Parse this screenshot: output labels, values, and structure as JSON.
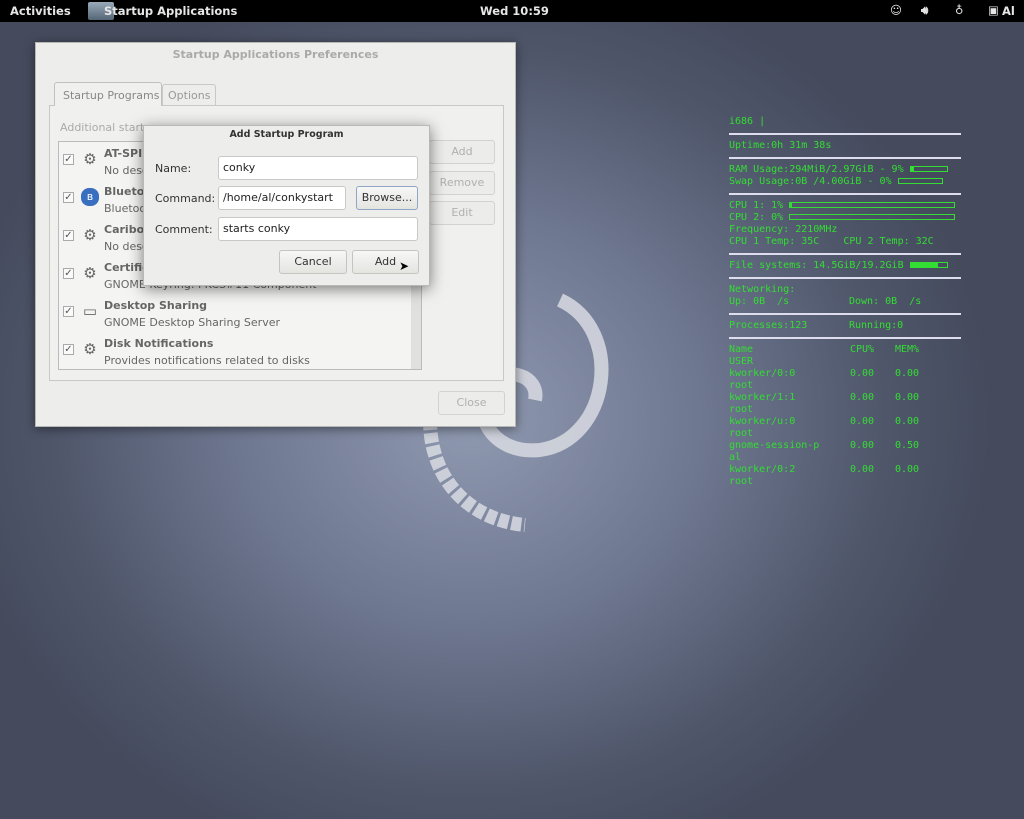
{
  "topbar": {
    "activities": "Activities",
    "app": "Startup Applications",
    "clock": "Wed 10:59",
    "user": "Al"
  },
  "main_window": {
    "title": "Startup Applications Preferences",
    "tabs": [
      "Startup Programs",
      "Options"
    ],
    "list_label": "Additional startup programs:",
    "items": [
      {
        "title": "AT-SPI",
        "subtitle": "No description",
        "icon": "gears-icon",
        "checked": true
      },
      {
        "title": "Bluetooth",
        "subtitle": "Bluetooth",
        "icon": "bluetooth-icon",
        "checked": true
      },
      {
        "title": "Caribou",
        "subtitle": "No description",
        "icon": "gears-icon",
        "checked": true
      },
      {
        "title": "Certificate",
        "subtitle": "GNOME Keyring: PKCS#11 Component",
        "icon": "gears-icon",
        "checked": true
      },
      {
        "title": "Desktop Sharing",
        "subtitle": "GNOME Desktop Sharing Server",
        "icon": "monitor-icon",
        "checked": true
      },
      {
        "title": "Disk Notifications",
        "subtitle": "Provides notifications related to disks",
        "icon": "gears-icon",
        "checked": true
      }
    ],
    "buttons": {
      "add": "Add",
      "remove": "Remove",
      "edit": "Edit",
      "close": "Close"
    }
  },
  "dialog": {
    "title": "Add Startup Program",
    "name_label": "Name:",
    "name_value": "conky",
    "command_label": "Command:",
    "command_value": "/home/al/conkystart",
    "browse": "Browse...",
    "comment_label": "Comment:",
    "comment_value": "starts conky",
    "cancel": "Cancel",
    "add": "Add"
  },
  "conky": {
    "arch": "i686 |",
    "uptime": "Uptime:0h 31m 38s",
    "ram": "RAM Usage:294MiB/2.97GiB - 9%",
    "ram_pct": 9,
    "swap": "Swap Usage:0B  /4.00GiB - 0%",
    "swap_pct": 0,
    "cpu1": "CPU 1: 1%",
    "cpu1_pct": 1,
    "cpu2": "CPU 2: 0%",
    "cpu2_pct": 0,
    "freq": "Frequency: 2210MHz",
    "temp": "CPU 1 Temp: 35C    CPU 2 Temp: 32C",
    "fs": "File systems: 14.5GiB/19.2GiB",
    "fs_pct": 75,
    "net": "Networking:",
    "up": "Up: 0B  /s",
    "down": "Down: 0B  /s",
    "procs": "Processes:123",
    "running": "Running:0",
    "headers": [
      "Name",
      "CPU%",
      "MEM%",
      "USER"
    ],
    "rows": [
      [
        "kworker/0:0",
        "0.00",
        "0.00",
        "root"
      ],
      [
        "kworker/1:1",
        "0.00",
        "0.00",
        "root"
      ],
      [
        "kworker/u:0",
        "0.00",
        "0.00",
        "root"
      ],
      [
        "gnome-session-p",
        "0.00",
        "0.50",
        "al"
      ],
      [
        "kworker/0:2",
        "0.00",
        "0.00",
        "root"
      ]
    ]
  },
  "colors": {
    "conky": "#33dd33",
    "topbar": "#000000"
  }
}
